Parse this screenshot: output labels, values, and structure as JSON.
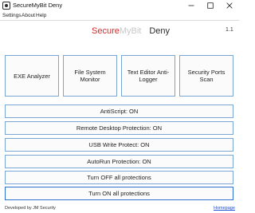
{
  "window": {
    "title": "SecureMyBit Deny"
  },
  "menu": {
    "items": [
      "Settings",
      "About",
      "Help"
    ]
  },
  "header": {
    "logo_secure": "Secure",
    "logo_mybit": "MyBit",
    "logo_deny": "Deny",
    "version": "1.1"
  },
  "tiles": [
    "EXE Analyzer",
    "File System Monitor",
    "Text Editor Anti-Logger",
    "Security Ports Scan"
  ],
  "toggles": {
    "antiscript": "AntiScript: ON",
    "remote_desktop": "Remote Desktop Protection: ON",
    "usb_write": "USB Write Protect: ON",
    "autorun": "AutoRun Protection: ON",
    "turn_off_all": "Turn OFF all protections",
    "turn_on_all": "Turn ON all protections"
  },
  "footer": {
    "developer": "Developed by JM Security",
    "homepage": "Homepage"
  }
}
